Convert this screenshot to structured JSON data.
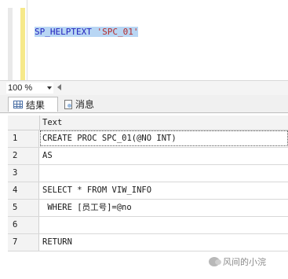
{
  "editor": {
    "code_keyword": "SP_HELPTEXT",
    "code_string": "'SPC_01'"
  },
  "zoom": {
    "value": "100 %"
  },
  "tabs": [
    {
      "label": "结果",
      "icon": "grid-icon"
    },
    {
      "label": "消息",
      "icon": "message-icon"
    }
  ],
  "results": {
    "column": "Text",
    "rows": [
      {
        "num": "1",
        "text": "CREATE PROC SPC_01(@NO INT)"
      },
      {
        "num": "2",
        "text": "AS"
      },
      {
        "num": "3",
        "text": ""
      },
      {
        "num": "4",
        "text": "SELECT * FROM VIW_INFO"
      },
      {
        "num": "5",
        "text": " WHERE [员工号]=@no"
      },
      {
        "num": "6",
        "text": ""
      },
      {
        "num": "7",
        "text": "RETURN"
      }
    ]
  },
  "watermark": {
    "text": "风间的小浣"
  }
}
